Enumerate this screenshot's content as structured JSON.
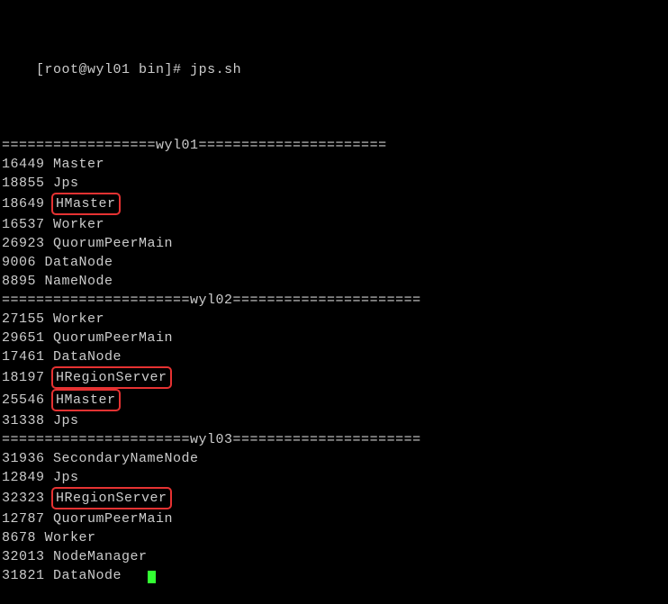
{
  "prompt": {
    "user_host": "[root@wyl01 bin]#",
    "command": "jps.sh"
  },
  "sections": [
    {
      "divider": "==================wyl01======================",
      "processes": [
        {
          "pid": "16449",
          "name": "Master",
          "highlighted": false
        },
        {
          "pid": "18855",
          "name": "Jps",
          "highlighted": false
        },
        {
          "pid": "18649",
          "name": "HMaster",
          "highlighted": true
        },
        {
          "pid": "16537",
          "name": "Worker",
          "highlighted": false
        },
        {
          "pid": "26923",
          "name": "QuorumPeerMain",
          "highlighted": false
        },
        {
          "pid": "9006",
          "name": "DataNode",
          "highlighted": false
        },
        {
          "pid": "8895",
          "name": "NameNode",
          "highlighted": false
        }
      ]
    },
    {
      "divider": "======================wyl02======================",
      "processes": [
        {
          "pid": "27155",
          "name": "Worker",
          "highlighted": false
        },
        {
          "pid": "29651",
          "name": "QuorumPeerMain",
          "highlighted": false
        },
        {
          "pid": "17461",
          "name": "DataNode",
          "highlighted": false
        },
        {
          "pid": "18197",
          "name": "HRegionServer",
          "highlighted": true
        },
        {
          "pid": "25546",
          "name": "HMaster",
          "highlighted": true
        },
        {
          "pid": "31338",
          "name": "Jps",
          "highlighted": false
        }
      ]
    },
    {
      "divider": "======================wyl03======================",
      "processes": [
        {
          "pid": "31936",
          "name": "SecondaryNameNode",
          "highlighted": false
        },
        {
          "pid": "12849",
          "name": "Jps",
          "highlighted": false
        },
        {
          "pid": "32323",
          "name": "HRegionServer",
          "highlighted": true
        },
        {
          "pid": "12787",
          "name": "QuorumPeerMain",
          "highlighted": false
        },
        {
          "pid": "8678",
          "name": "Worker",
          "highlighted": false
        },
        {
          "pid": "32013",
          "name": "NodeManager",
          "highlighted": false
        },
        {
          "pid": "31821",
          "name": "DataNode",
          "highlighted": false
        }
      ]
    }
  ],
  "colors": {
    "background": "#000000",
    "text": "#cccccc",
    "highlight_border": "#e63232",
    "cursor": "#33ff33"
  }
}
